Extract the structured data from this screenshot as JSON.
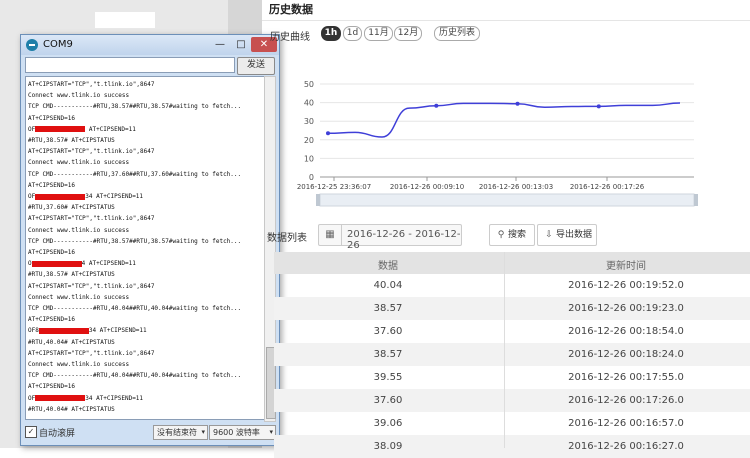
{
  "serial": {
    "title": "COM9",
    "send_label": "发送",
    "input_value": "",
    "autoscroll_label": "自动滚屏",
    "autoscroll_checked": "✓",
    "line_ending": "没有结束符",
    "baud": "9600 波特率",
    "lines": [
      {
        "text": "AT+CIPSTART=\"TCP\",\"t.tlink.io\",8647"
      },
      {
        "text": "Connect www.tlink.io success"
      },
      {
        "text": "TCP CMD-----------#RTU,38.57##RTU,38.57#waiting to fetch..."
      },
      {
        "text": "AT+CIPSEND=16"
      },
      {
        "pre": "OF",
        "post": " AT+CIPSEND=11"
      },
      {
        "text": "#RTU,38.57# AT+CIPSTATUS"
      },
      {
        "text": "AT+CIPSTART=\"TCP\",\"t.tlink.io\",8647"
      },
      {
        "text": "Connect www.tlink.io success"
      },
      {
        "text": "TCP CMD-----------#RTU,37.60##RTU,37.60#waiting to fetch..."
      },
      {
        "text": "AT+CIPSEND=16"
      },
      {
        "pre": "OF",
        "post": "34 AT+CIPSEND=11"
      },
      {
        "text": "#RTU,37.60# AT+CIPSTATUS"
      },
      {
        "text": "AT+CIPSTART=\"TCP\",\"t.tlink.io\",8647"
      },
      {
        "text": "Connect www.tlink.io success"
      },
      {
        "text": "TCP CMD-----------#RTU,38.57##RTU,38.57#waiting to fetch..."
      },
      {
        "text": "AT+CIPSEND=16"
      },
      {
        "pre": "O",
        "post": "4 AT+CIPSEND=11"
      },
      {
        "text": "#RTU,38.57# AT+CIPSTATUS"
      },
      {
        "text": "AT+CIPSTART=\"TCP\",\"t.tlink.io\",8647"
      },
      {
        "text": "Connect www.tlink.io success"
      },
      {
        "text": "TCP CMD-----------#RTU,40.04##RTU,40.04#waiting to fetch..."
      },
      {
        "text": "AT+CIPSEND=16"
      },
      {
        "pre": "OF8",
        "post": "34 AT+CIPSEND=11"
      },
      {
        "text": "#RTU,40.04# AT+CIPSTATUS"
      },
      {
        "text": "AT+CIPSTART=\"TCP\",\"t.tlink.io\",8647"
      },
      {
        "text": "Connect www.tlink.io success"
      },
      {
        "text": "TCP CMD-----------#RTU,40.04##RTU,40.04#waiting to fetch..."
      },
      {
        "text": "AT+CIPSEND=16"
      },
      {
        "pre": "OF",
        "post": "34 AT+CIPSEND=11"
      },
      {
        "text": "#RTU,40.04# AT+CIPSTATUS"
      }
    ]
  },
  "history": {
    "title": "历史数据",
    "curve_label": "历史曲线",
    "ranges": [
      {
        "label": "1h",
        "active": true
      },
      {
        "label": "1d",
        "active": false
      },
      {
        "label": "11月",
        "active": false
      },
      {
        "label": "12月",
        "active": false
      },
      {
        "label": "历史列表",
        "active": false
      }
    ],
    "list_label": "数据列表",
    "date_range": "2016-12-26 - 2016-12-26",
    "calendar_icon": "calendar-icon",
    "search_label": "搜索",
    "export_label": "导出数据",
    "table": {
      "headers": [
        "数据",
        "更新时间"
      ],
      "rows": [
        [
          "40.04",
          "2016-12-26 00:19:52.0"
        ],
        [
          "38.57",
          "2016-12-26 00:19:23.0"
        ],
        [
          "37.60",
          "2016-12-26 00:18:54.0"
        ],
        [
          "38.57",
          "2016-12-26 00:18:24.0"
        ],
        [
          "39.55",
          "2016-12-26 00:17:55.0"
        ],
        [
          "37.60",
          "2016-12-26 00:17:26.0"
        ],
        [
          "39.06",
          "2016-12-26 00:16:57.0"
        ],
        [
          "38.09",
          "2016-12-26 00:16:27.0"
        ]
      ]
    }
  },
  "chart_data": {
    "type": "line",
    "title": "",
    "xlabel": "",
    "ylabel": "",
    "ylim": [
      0,
      50
    ],
    "yticks": [
      0,
      10,
      20,
      30,
      40,
      50
    ],
    "xtick_labels": [
      "2016-12-25 23:36:07",
      "2016-12-26 00:09:10",
      "2016-12-26 00:13:03",
      "2016-12-26 00:17:26"
    ],
    "color": "#3f3fd8",
    "grid": true,
    "series": [
      {
        "values": [
          23.5,
          24.0,
          21.5,
          37.0,
          38.3,
          39.6,
          39.6,
          39.4,
          37.5,
          37.9,
          38.0,
          38.5,
          38.5,
          39.8
        ]
      }
    ],
    "markers": [
      0,
      4,
      7,
      10
    ]
  },
  "colors": {
    "accent": "#333333",
    "line": "#3f3fd8",
    "redact": "#e01010"
  }
}
